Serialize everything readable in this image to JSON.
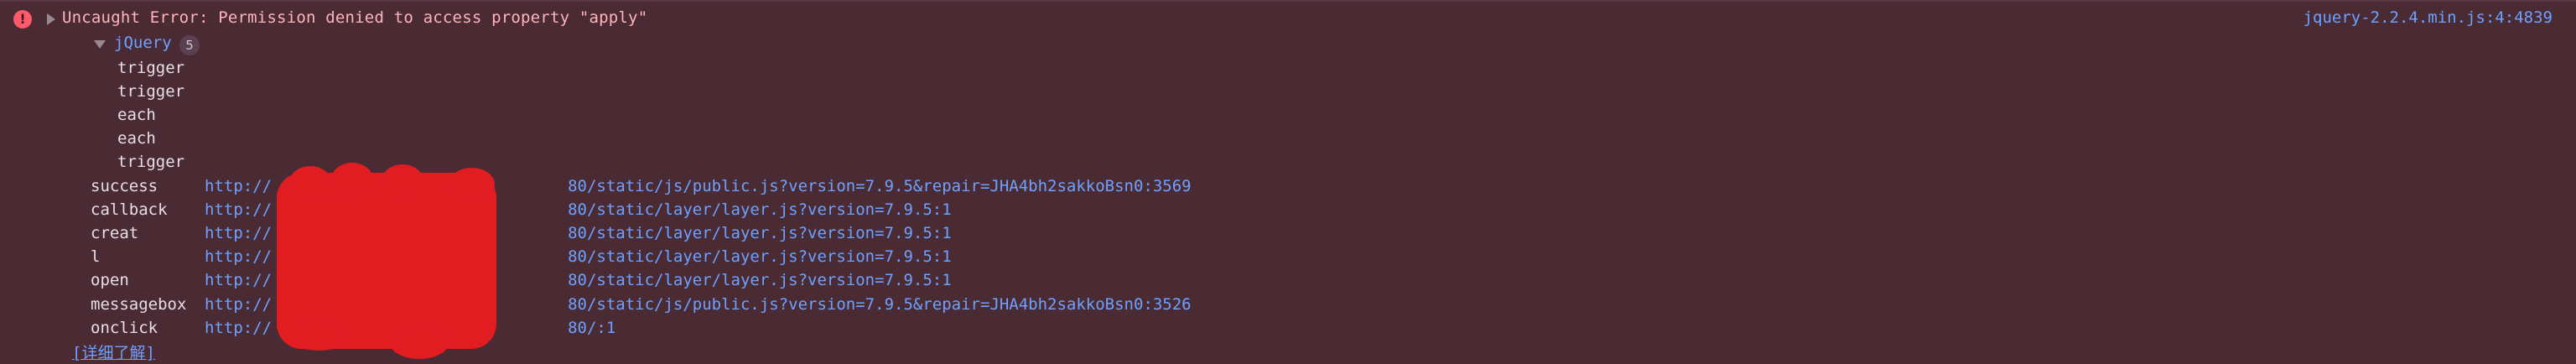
{
  "error": {
    "message": "Uncaught Error: Permission denied to access property \"apply\"",
    "source": "jquery-2.2.4.min.js:4:4839"
  },
  "group": {
    "name": "jQuery",
    "count": "5",
    "items": [
      "trigger",
      "trigger",
      "each",
      "each",
      "trigger"
    ]
  },
  "frames": [
    {
      "name": "success",
      "url": "http://",
      "url_tail": "80/static/js/public.js?version=7.9.5&repair=JHA4bh2sakkoBsn0:3569"
    },
    {
      "name": "callback",
      "url": "http://",
      "url_tail": "80/static/layer/layer.js?version=7.9.5:1"
    },
    {
      "name": "creat",
      "url": "http://",
      "url_tail": "80/static/layer/layer.js?version=7.9.5:1"
    },
    {
      "name": "l",
      "url": "http://",
      "url_tail": "80/static/layer/layer.js?version=7.9.5:1"
    },
    {
      "name": "open",
      "url": "http://",
      "url_tail": "80/static/layer/layer.js?version=7.9.5:1"
    },
    {
      "name": "messagebox",
      "url": "http://",
      "url_tail": "80/static/js/public.js?version=7.9.5&repair=JHA4bh2sakkoBsn0:3526"
    },
    {
      "name": "onclick",
      "url": "http://",
      "url_tail": "80/:1"
    }
  ],
  "learn_more": "[详细了解]",
  "icons": {
    "error": "error-circle-icon",
    "expand": "triangle-right-icon",
    "group_toggle": "triangle-down-icon"
  },
  "colors": {
    "background": "#4a2b34",
    "error_text": "#ffb4bd",
    "link": "#6ea1ff",
    "redaction": "#e21d22"
  }
}
